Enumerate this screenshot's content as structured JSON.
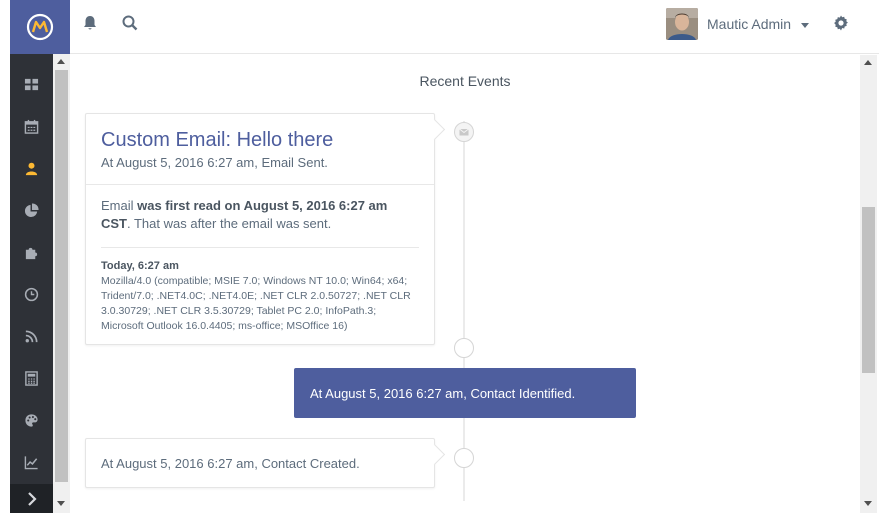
{
  "header": {
    "user_name": "Mautic Admin"
  },
  "sidebar": {
    "icons": [
      "dashboard-icon",
      "calendar-icon",
      "contacts-icon",
      "pie-chart-icon",
      "components-icon",
      "clock-icon",
      "rss-icon",
      "calculator-icon",
      "palette-icon",
      "line-chart-icon"
    ],
    "active_index": 2,
    "accent": "#fdb933"
  },
  "main": {
    "section_title": "Recent Events",
    "event1": {
      "title": "Custom Email: Hello there",
      "subtitle": "At August 5, 2016 6:27 am, Email Sent.",
      "text_pre": "Email ",
      "text_bold": "was first read on August 5, 2016 6:27 am CST",
      "text_post": ". That was after the email was sent.",
      "ua_title": "Today, 6:27 am",
      "ua_text": "Mozilla/4.0 (compatible; MSIE 7.0; Windows NT 10.0; Win64; x64; Trident/7.0; .NET4.0C; .NET4.0E; .NET CLR 2.0.50727; .NET CLR 3.0.30729; .NET CLR 3.5.30729; Tablet PC 2.0; InfoPath.3; Microsoft Outlook 16.0.4405; ms-office; MSOffice 16)"
    },
    "event2": {
      "text": "At August 5, 2016 6:27 am, Contact Identified."
    },
    "event3": {
      "text": "At August 5, 2016 6:27 am, Contact Created."
    }
  },
  "colors": {
    "brand": "#4e5e9e",
    "sidebar_bg": "#2e3137"
  }
}
